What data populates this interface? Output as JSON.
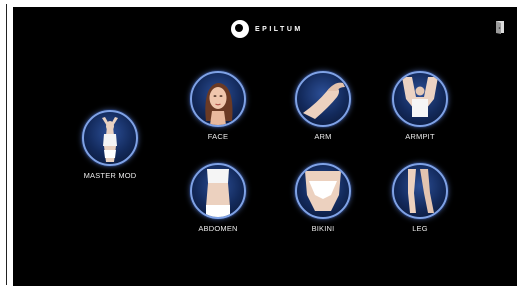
{
  "brand": {
    "name": "EPILTUM"
  },
  "menu": {
    "items": [
      {
        "id": "master",
        "label": "MASTER MOD"
      },
      {
        "id": "face",
        "label": "FACE"
      },
      {
        "id": "arm",
        "label": "ARM"
      },
      {
        "id": "armpit",
        "label": "ARMPIT"
      },
      {
        "id": "abdomen",
        "label": "ABDOMEN"
      },
      {
        "id": "bikini",
        "label": "BIKINI"
      },
      {
        "id": "leg",
        "label": "LEG"
      }
    ]
  },
  "icons": {
    "exit": "exit-door-icon",
    "logo": "epiltum-logo-icon"
  },
  "colors": {
    "background": "#000000",
    "ring": "#7fa2e6",
    "circle_fill": "#1d3a78",
    "label": "#eaeaea"
  }
}
